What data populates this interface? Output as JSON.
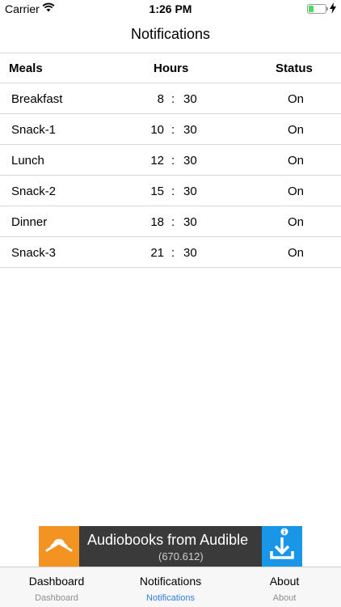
{
  "status_bar": {
    "carrier": "Carrier",
    "time": "1:26 PM",
    "battery_level": 0.3
  },
  "nav": {
    "title": "Notifications"
  },
  "table": {
    "headers": {
      "meals": "Meals",
      "hours": "Hours",
      "status": "Status"
    },
    "rows": [
      {
        "meal": "Breakfast",
        "hour": "8",
        "minute": "30",
        "status": "On"
      },
      {
        "meal": "Snack-1",
        "hour": "10",
        "minute": "30",
        "status": "On"
      },
      {
        "meal": "Lunch",
        "hour": "12",
        "minute": "30",
        "status": "On"
      },
      {
        "meal": "Snack-2",
        "hour": "15",
        "minute": "30",
        "status": "On"
      },
      {
        "meal": "Dinner",
        "hour": "18",
        "minute": "30",
        "status": "On"
      },
      {
        "meal": "Snack-3",
        "hour": "21",
        "minute": "30",
        "status": "On"
      }
    ],
    "separator": ":"
  },
  "ad": {
    "title": "Audiobooks from Audible",
    "subtitle": "(670.612)",
    "colors": {
      "logo_bg": "#f39322",
      "banner_bg": "#3a3a3a",
      "download_bg": "#1996e8"
    },
    "icons": {
      "logo": "audible-logo-icon",
      "info": "ad-info-icon",
      "download": "download-icon"
    }
  },
  "tabbar": {
    "tabs": [
      {
        "label": "Dashboard",
        "sub": "Dashboard",
        "active": false
      },
      {
        "label": "Notifications",
        "sub": "Notifications",
        "active": true
      },
      {
        "label": "About",
        "sub": "About",
        "active": false
      }
    ],
    "active_color": "#2f7de1"
  }
}
